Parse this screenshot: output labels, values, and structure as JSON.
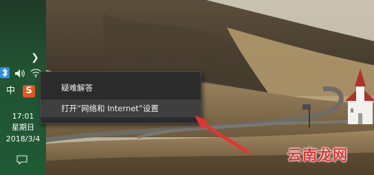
{
  "taskbar": {
    "input_mode": "中",
    "sogou_label": "S",
    "clock": {
      "time": "17:01",
      "day": "星期日",
      "date": "2018/3/4"
    }
  },
  "context_menu": {
    "items": [
      {
        "label": "疑难解答"
      },
      {
        "label": "打开“网络和 Internet”设置"
      }
    ]
  },
  "annotation": {
    "arrow_color": "#e53333"
  },
  "watermark": {
    "text": "云南龙网"
  }
}
